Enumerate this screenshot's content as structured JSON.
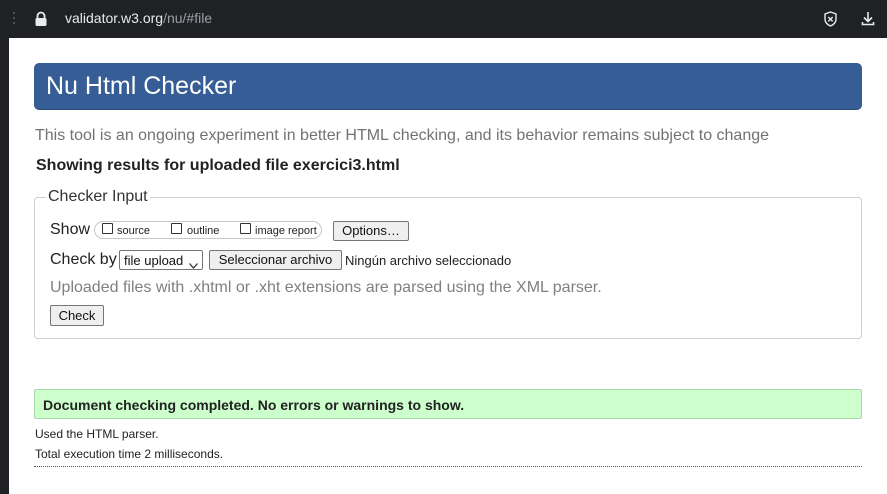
{
  "browser": {
    "url_host": "validator.w3.org",
    "url_path": "/nu/#file"
  },
  "header": {
    "title": "Nu Html Checker"
  },
  "intro": {
    "lead": "This tool is an ongoing experiment in better HTML checking, and its behavior remains subject to change",
    "results_heading": "Showing results for uploaded file exercici3.html"
  },
  "checker_input": {
    "legend": "Checker Input",
    "show_label": "Show",
    "show_options": [
      {
        "label": "source",
        "checked": false
      },
      {
        "label": "outline",
        "checked": false
      },
      {
        "label": "image report",
        "checked": false
      }
    ],
    "options_button": "Options…",
    "check_by_label": "Check by",
    "check_by_value": "file upload",
    "file_button": "Seleccionar archivo",
    "file_status": "Ningún archivo seleccionado",
    "hint": "Uploaded files with .xhtml or .xht extensions are parsed using the XML parser.",
    "check_button": "Check"
  },
  "results": {
    "success_message": "Document checking completed. No errors or warnings to show.",
    "parser_note": "Used the HTML parser.",
    "execution_time": "Total execution time 2 milliseconds."
  },
  "colors": {
    "title_bar": "#365d95",
    "success_bg": "#ccffcc",
    "browser_chrome": "#202124"
  }
}
